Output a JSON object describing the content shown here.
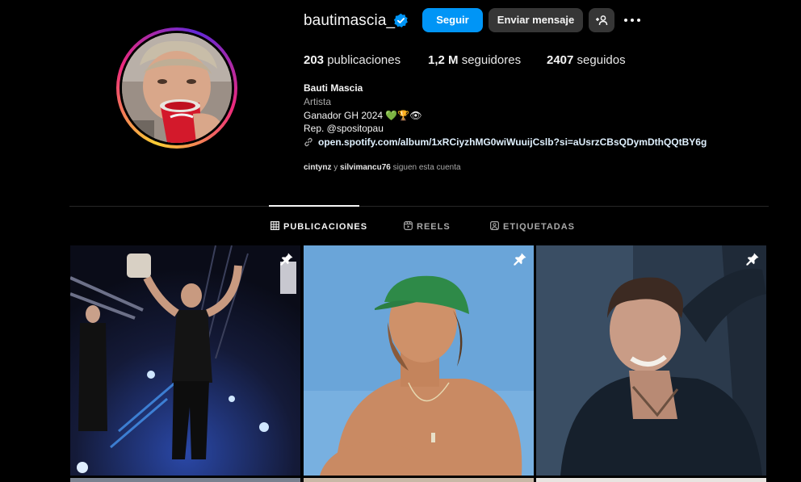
{
  "profile": {
    "username": "bautimascia_",
    "verified": true,
    "buttons": {
      "follow": "Seguir",
      "message": "Enviar mensaje"
    },
    "stats": {
      "posts_count": "203",
      "posts_label": "publicaciones",
      "followers_count": "1,2 M",
      "followers_label": "seguidores",
      "following_count": "2407",
      "following_label": "seguidos"
    },
    "bio": {
      "name": "Bauti Mascia",
      "category": "Artista",
      "line1_text": "Ganador GH 2024",
      "line1_emojis": [
        "💚",
        "🏆",
        "👁"
      ],
      "line2": "Rep. @spositopau",
      "link": "open.spotify.com/album/1xRCiyzhMG0wiWuuijCslb?si=aUsrzCBsQDymDthQQtBY6g"
    },
    "followed_by": {
      "user1": "cintynz",
      "conjunction": "y",
      "user2": "silvimancu76",
      "suffix": "siguen esta cuenta"
    }
  },
  "tabs": [
    {
      "label": "PUBLICACIONES",
      "icon": "grid-icon",
      "active": true
    },
    {
      "label": "REELS",
      "icon": "reels-icon",
      "active": false
    },
    {
      "label": "ETIQUETADAS",
      "icon": "tagged-icon",
      "active": false
    }
  ],
  "posts": [
    {
      "pinned": true,
      "icon": "pin-icon"
    },
    {
      "pinned": true,
      "icon": "pin-icon"
    },
    {
      "pinned": true,
      "icon": "pin-icon"
    }
  ],
  "colors": {
    "background": "#000000",
    "accent": "#0095f6",
    "button_secondary": "#363636",
    "muted_text": "#a8a8a8"
  }
}
